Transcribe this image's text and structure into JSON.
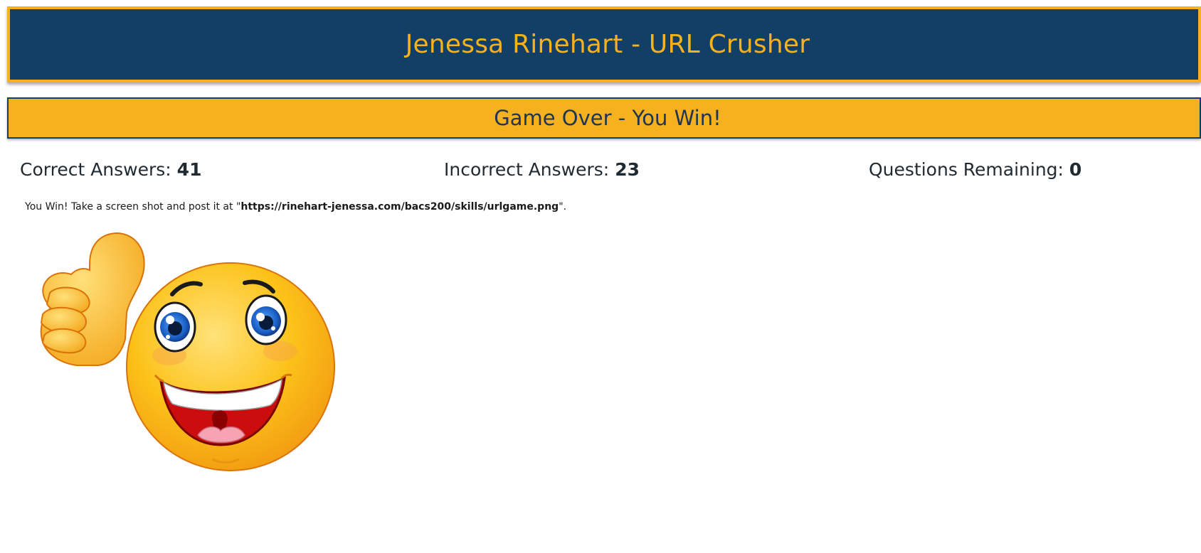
{
  "header": {
    "title": "Jenessa Rinehart - URL Crusher"
  },
  "status": {
    "text": "Game Over - You Win!"
  },
  "scores": {
    "correct_label": "Correct Answers: ",
    "correct_value": "41",
    "incorrect_label": "Incorrect Answers: ",
    "incorrect_value": "23",
    "remaining_label": "Questions Remaining: ",
    "remaining_value": "0"
  },
  "message": {
    "prefix": "You Win! Take a screen shot and post it at \"",
    "url": "https://rinehart-jenessa.com/bacs200/skills/urlgame.png",
    "suffix": "\"."
  },
  "image": {
    "icon": "thumbs-up-smiley-icon"
  },
  "colors": {
    "navy": "#123f65",
    "gold": "#f5b11e"
  }
}
